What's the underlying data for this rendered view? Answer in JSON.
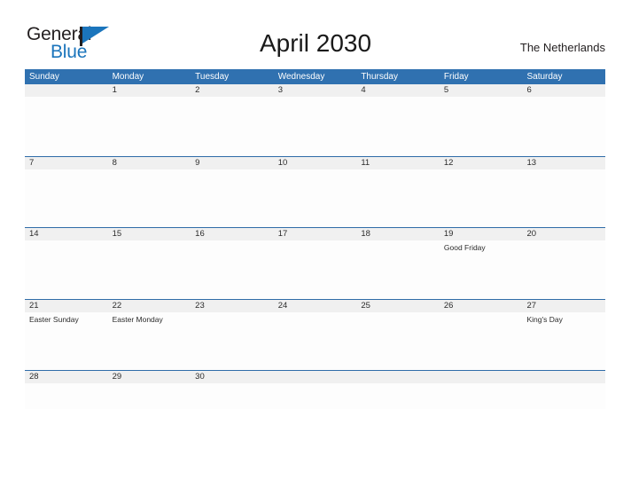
{
  "brand": {
    "word_one": "General",
    "word_two": "Blue",
    "logo_icon": "sail-triangle-icon",
    "accent_color": "#1b75bc"
  },
  "header": {
    "title": "April 2030",
    "region": "The Netherlands"
  },
  "theme": {
    "header_blue": "#3071b0",
    "row_divider": "#2f6ca8",
    "band_gray": "#f0f0f0",
    "text": "#2b2b2b"
  },
  "calendar": {
    "weekdays": [
      "Sunday",
      "Monday",
      "Tuesday",
      "Wednesday",
      "Thursday",
      "Friday",
      "Saturday"
    ],
    "weeks": [
      [
        {
          "day": "",
          "event": ""
        },
        {
          "day": "1",
          "event": ""
        },
        {
          "day": "2",
          "event": ""
        },
        {
          "day": "3",
          "event": ""
        },
        {
          "day": "4",
          "event": ""
        },
        {
          "day": "5",
          "event": ""
        },
        {
          "day": "6",
          "event": ""
        }
      ],
      [
        {
          "day": "7",
          "event": ""
        },
        {
          "day": "8",
          "event": ""
        },
        {
          "day": "9",
          "event": ""
        },
        {
          "day": "10",
          "event": ""
        },
        {
          "day": "11",
          "event": ""
        },
        {
          "day": "12",
          "event": ""
        },
        {
          "day": "13",
          "event": ""
        }
      ],
      [
        {
          "day": "14",
          "event": ""
        },
        {
          "day": "15",
          "event": ""
        },
        {
          "day": "16",
          "event": ""
        },
        {
          "day": "17",
          "event": ""
        },
        {
          "day": "18",
          "event": ""
        },
        {
          "day": "19",
          "event": "Good Friday"
        },
        {
          "day": "20",
          "event": ""
        }
      ],
      [
        {
          "day": "21",
          "event": "Easter Sunday"
        },
        {
          "day": "22",
          "event": "Easter Monday"
        },
        {
          "day": "23",
          "event": ""
        },
        {
          "day": "24",
          "event": ""
        },
        {
          "day": "25",
          "event": ""
        },
        {
          "day": "26",
          "event": ""
        },
        {
          "day": "27",
          "event": "King's Day"
        }
      ],
      [
        {
          "day": "28",
          "event": ""
        },
        {
          "day": "29",
          "event": ""
        },
        {
          "day": "30",
          "event": ""
        },
        {
          "day": "",
          "event": ""
        },
        {
          "day": "",
          "event": ""
        },
        {
          "day": "",
          "event": ""
        },
        {
          "day": "",
          "event": ""
        }
      ]
    ]
  }
}
